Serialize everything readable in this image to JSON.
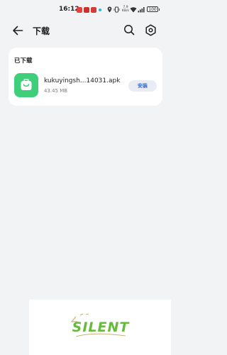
{
  "status_bar": {
    "time": "16:12",
    "net_speed_top": "7.9",
    "net_speed_bottom": "KB/s",
    "battery": "100",
    "notification_colors": [
      "#e0443c",
      "#c8322a",
      "#d23b3b"
    ],
    "dot_color": "#27b8d6"
  },
  "header": {
    "title": "下载",
    "back_icon": "arrow-left-icon",
    "search_icon": "search-icon",
    "settings_icon": "gear-icon"
  },
  "downloaded_section": {
    "title": "已下载",
    "items": [
      {
        "file_name": "kukuyingsh...14031.apk",
        "file_size": "43.45 MB",
        "action_label": "安装",
        "icon": "shopping-bag-icon",
        "icon_color": "#3fcf7a"
      }
    ]
  },
  "watermark": {
    "text": "SILENT"
  },
  "colors": {
    "background": "#f1f3f5",
    "card": "#ffffff",
    "accent": "#2f66d9"
  }
}
